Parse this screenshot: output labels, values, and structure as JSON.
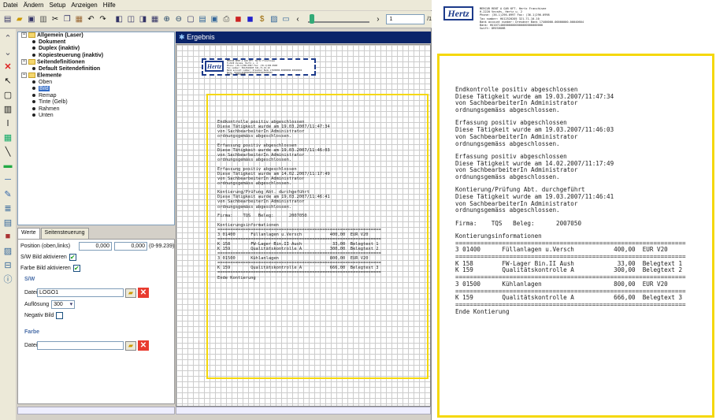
{
  "menu": [
    "Datei",
    "Ändern",
    "Setup",
    "Anzeigen",
    "Hilfe"
  ],
  "toolbar": {
    "page_current": "1",
    "page_total": "/1"
  },
  "tree": [
    {
      "label": "Allgemein (Laser)",
      "level": 0,
      "bold": true,
      "folder": true
    },
    {
      "label": "Dokument",
      "level": 2,
      "bold": true
    },
    {
      "label": "Duplex (inaktiv)",
      "level": 2,
      "bold": true
    },
    {
      "label": "Kopiesteuerung (inaktiv)",
      "level": 2,
      "bold": true
    },
    {
      "label": "Seitendefinitionen",
      "level": 0,
      "bold": true,
      "folder": true
    },
    {
      "label": "Default Seitendefinition",
      "level": 2,
      "bold": true
    },
    {
      "label": "Elemente",
      "level": 0,
      "bold": true,
      "folder": true
    },
    {
      "label": "Oben",
      "level": 2
    },
    {
      "label": "Bild",
      "level": 2,
      "selected": true
    },
    {
      "label": "Remap",
      "level": 2
    },
    {
      "label": "Tinte (Gelb)",
      "level": 2
    },
    {
      "label": "Rahmen",
      "level": 2
    },
    {
      "label": "Unten",
      "level": 2
    }
  ],
  "tabs": [
    "Werte",
    "Seitensteuerung"
  ],
  "props": {
    "position_label": "Position (oben,links)",
    "pos_x": "0,000",
    "pos_y": "0,000",
    "range": "(0-99.239)",
    "sw_aktiv_label": "S/W Bild aktivieren",
    "farbe_aktiv_label": "Farbe Bild aktivieren",
    "sw_section": "S/W",
    "datei_label": "Datei",
    "datei_value": "LOGO1",
    "aufloesung_label": "Auflösung",
    "aufloesung_value": "300",
    "negativ_label": "Negativ Bild",
    "farbe_section": "Farbe",
    "datei2_label": "Datei",
    "datei2_value": ""
  },
  "result_title": "Ergebnis",
  "logo_text": "Hertz",
  "company_header": [
    "MERCUR RENT A GAR KFT. Hertz Franchisee",
    "H-2220 Vecsés, Hertz u. 2",
    "Phone: (36-1)296-0997  Fax: (36-1)296-0998",
    "Tax number: HU12520205  321-71-10-10",
    "Bank account number: Dresdner Bank  17400000-00000000-00040604",
    "Bank: HU10714000000000000000000000000",
    "Swift: DRESHUHB"
  ],
  "document_text": [
    "Endkontrolle positiv abgeschlossen",
    "Diese Tätigkeit wurde am 19.03.2007/11:47:34",
    "von SachbearbeiterIn Administrator",
    "ordnungsgemäss abgeschlossen.",
    "",
    "Erfassung positiv abgeschlossen",
    "Diese Tätigkeit wurde am 19.03.2007/11:46:03",
    "von SachbearbeiterIn Administrator",
    "ordnungsgemäss abgeschlossen.",
    "",
    "Erfassung positiv abgeschlossen",
    "Diese Tätigkeit wurde am 14.02.2007/11:17:49",
    "von SachbearbeiterIn Administrator",
    "ordnungsgemäss abgeschlossen.",
    "",
    "Kontierung/Prüfung Abt. durchgeführt",
    "Diese Tätigkeit wurde am 19.03.2007/11:46:41",
    "von SachbearbeiterIn Administrator",
    "ordnungsgemäss abgeschlossen.",
    "",
    "Firma:    TQS   Beleg:      2007050",
    "",
    "Kontierungsinformationen",
    "================================================================",
    "3 01400      Füllanlagen u.Versch           400,00  EUR V20",
    "================================================================",
    "K 158        FW-Lager Bin.II Aush            33,00  Belegtext 1",
    "K 159        Qualitätskontrolle A           300,00  Belegtext 2",
    "================================================================",
    "3 01500      Kühlanlagen                    800,00  EUR V20",
    "================================================================",
    "K 159        Qualitätskontrolle A           666,00  Belegtext 3",
    "================================================================",
    "Ende Kontierung"
  ]
}
